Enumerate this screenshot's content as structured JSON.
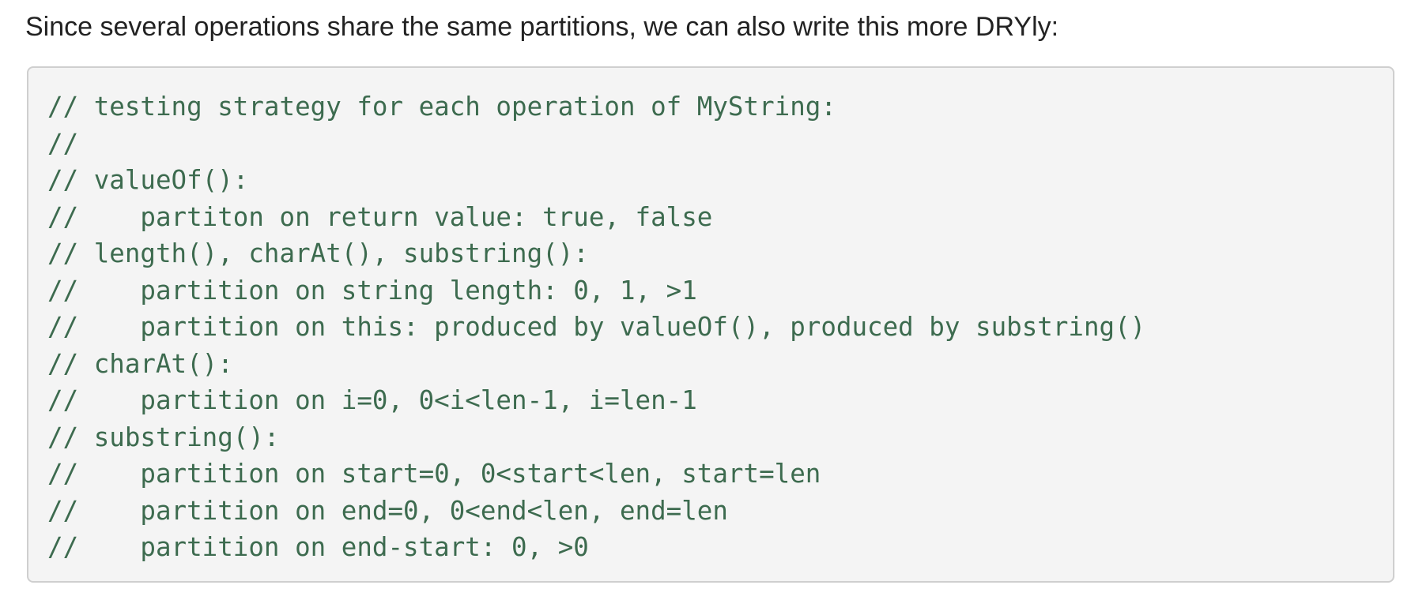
{
  "intro_text": "Since several operations share the same partitions, we can also write this more DRYly:",
  "code": {
    "lines": [
      "// testing strategy for each operation of MyString:",
      "//",
      "// valueOf():",
      "//    partiton on return value: true, false",
      "// length(), charAt(), substring():",
      "//    partition on string length: 0, 1, >1",
      "//    partition on this: produced by valueOf(), produced by substring()",
      "// charAt():",
      "//    partition on i=0, 0<i<len-1, i=len-1",
      "// substring():",
      "//    partition on start=0, 0<start<len, start=len",
      "//    partition on end=0, 0<end<len, end=len",
      "//    partition on end-start: 0, >0"
    ],
    "text_color": "#3d6b4f",
    "background_color": "#f4f4f4"
  }
}
